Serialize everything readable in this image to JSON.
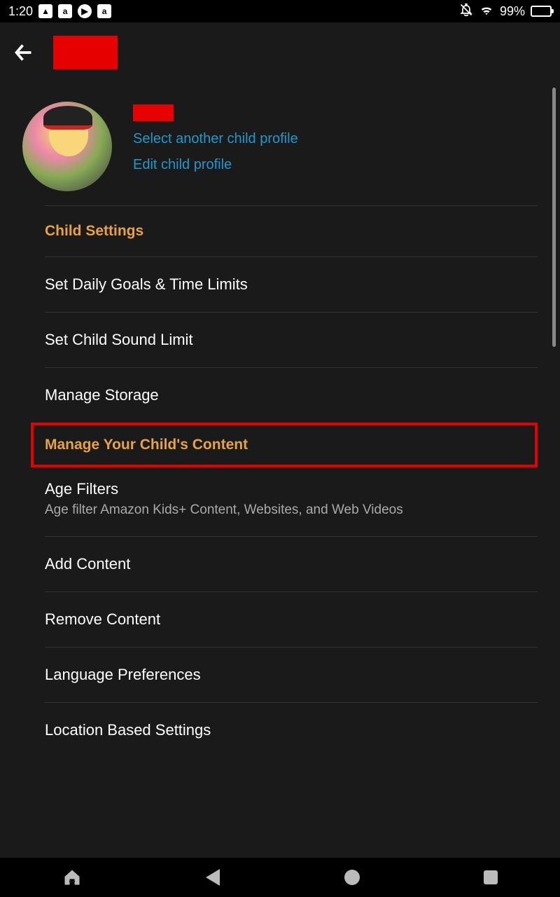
{
  "status": {
    "time": "1:20",
    "battery_pct": "99%"
  },
  "profile": {
    "select_another": "Select another child profile",
    "edit": "Edit child profile"
  },
  "sections": {
    "child_settings": "Child Settings",
    "manage_content": "Manage Your Child's Content"
  },
  "items": {
    "daily_goals": "Set Daily Goals & Time Limits",
    "sound_limit": "Set Child Sound Limit",
    "manage_storage": "Manage Storage",
    "age_filters": "Age Filters",
    "age_filters_sub": "Age filter Amazon Kids+ Content, Websites, and Web Videos",
    "add_content": "Add Content",
    "remove_content": "Remove Content",
    "language_prefs": "Language Preferences",
    "location_settings": "Location Based Settings"
  }
}
